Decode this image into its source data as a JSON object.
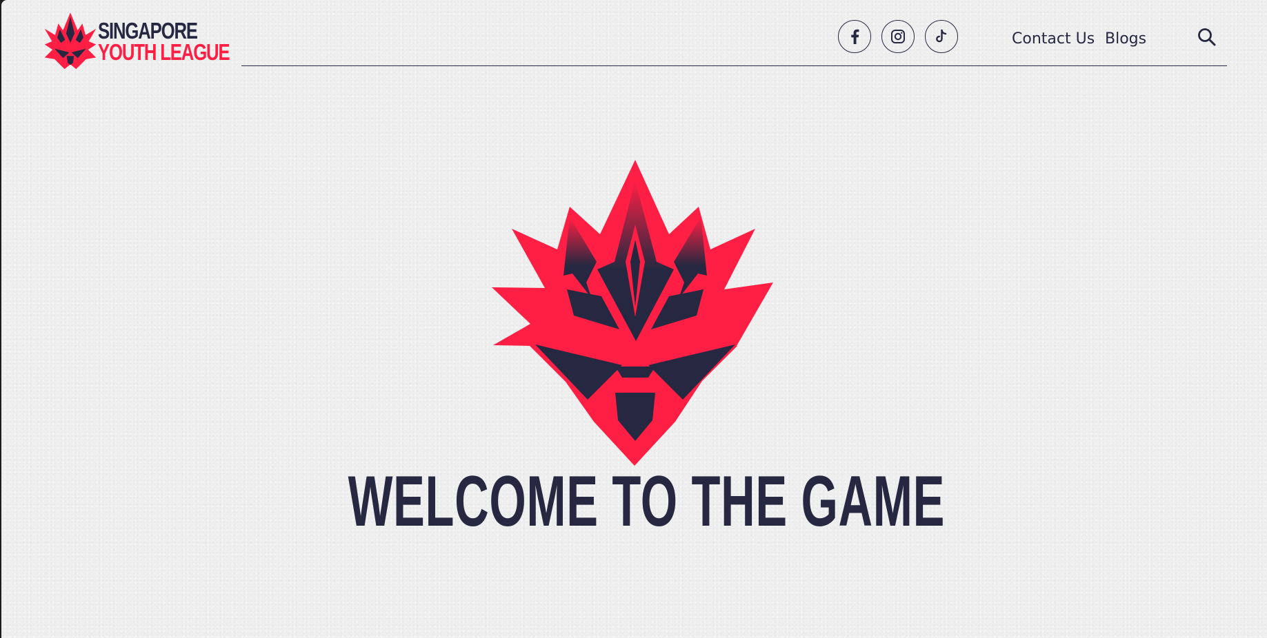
{
  "header": {
    "brand": {
      "line1": "SINGAPORE",
      "line2": "YOUTH LEAGUE",
      "icon": "lion-head-logo-icon"
    },
    "social": [
      {
        "name": "Facebook",
        "icon": "facebook-icon"
      },
      {
        "name": "Instagram",
        "icon": "instagram-icon"
      },
      {
        "name": "TikTok",
        "icon": "tiktok-icon"
      }
    ],
    "nav": {
      "contact_label": "Contact Us",
      "blogs_label": "Blogs"
    },
    "search_icon": "search-icon"
  },
  "hero": {
    "title": "WELCOME TO THE GAME",
    "icon": "lion-head-emblem-icon"
  },
  "colors": {
    "brand_red": "#ff1f44",
    "brand_navy": "#252840",
    "background": "#efefef"
  }
}
